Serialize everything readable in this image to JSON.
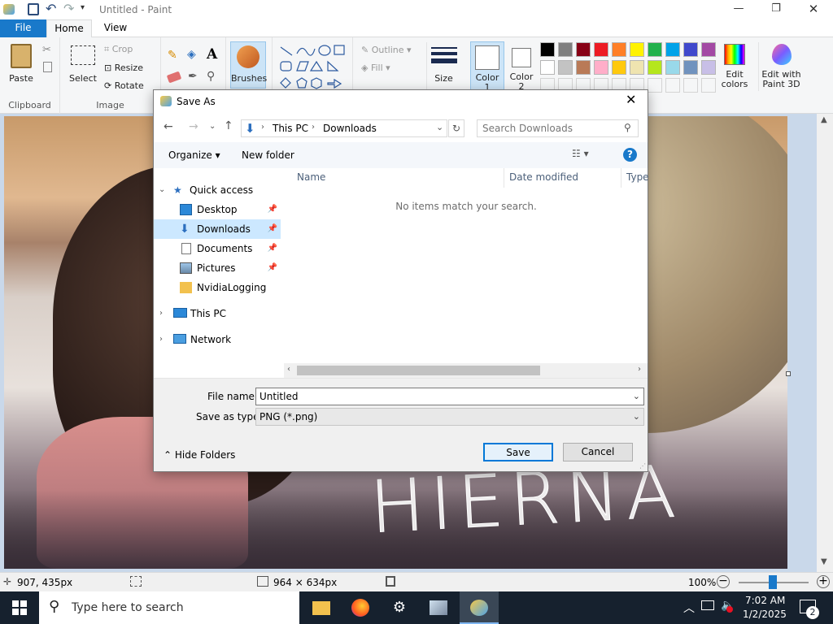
{
  "app": {
    "title": "Untitled - Paint"
  },
  "tabs": {
    "file": "File",
    "home": "Home",
    "view": "View"
  },
  "ribbon": {
    "clipboard": {
      "paste": "Paste",
      "label": "Clipboard"
    },
    "image": {
      "select": "Select",
      "crop": "Crop",
      "resize": "Resize",
      "rotate": "Rotate",
      "label": "Image"
    },
    "tools": {
      "brushes": "Brushes"
    },
    "shapes": {
      "outline": "Outline",
      "fill": "Fill"
    },
    "size": "Size",
    "colors": {
      "color1_a": "Color",
      "color1_b": "1",
      "color2_a": "Color",
      "color2_b": "2",
      "edit_a": "Edit",
      "edit_b": "colors",
      "paint3d_a": "Edit with",
      "paint3d_b": "Paint 3D"
    },
    "palette_row1": [
      "#000000",
      "#7f7f7f",
      "#880015",
      "#ed1c24",
      "#ff7f27",
      "#fff200",
      "#22b14c",
      "#00a2e8",
      "#3f48cc",
      "#a349a4"
    ],
    "palette_row2": [
      "#ffffff",
      "#c3c3c3",
      "#b97a57",
      "#ffaec9",
      "#ffc90e",
      "#efe4b0",
      "#b5e61d",
      "#99d9ea",
      "#7092be",
      "#c8bfe7"
    ]
  },
  "canvas_text": "HIERNA",
  "dialog": {
    "title": "Save As",
    "path": [
      "This PC",
      "Downloads"
    ],
    "search_placeholder": "Search Downloads",
    "organize": "Organize",
    "new_folder": "New folder",
    "help": "?",
    "nav": {
      "quick_access": "Quick access",
      "items": [
        "Desktop",
        "Downloads",
        "Documents",
        "Pictures",
        "NvidiaLogging"
      ],
      "this_pc": "This PC",
      "network": "Network"
    },
    "columns": {
      "name": "Name",
      "date": "Date modified",
      "type": "Type"
    },
    "empty_message": "No items match your search.",
    "file_name_label": "File name:",
    "file_name_value": "Untitled",
    "save_type_label": "Save as type:",
    "save_type_value": "PNG (*.png)",
    "hide_folders": "Hide Folders",
    "save": "Save",
    "cancel": "Cancel"
  },
  "status": {
    "cursor": "907, 435px",
    "size": "964 × 634px",
    "zoom": "100%"
  },
  "taskbar": {
    "search": "Type here to search",
    "time": "7:02 AM",
    "date": "1/2/2025",
    "notifications": "2"
  }
}
